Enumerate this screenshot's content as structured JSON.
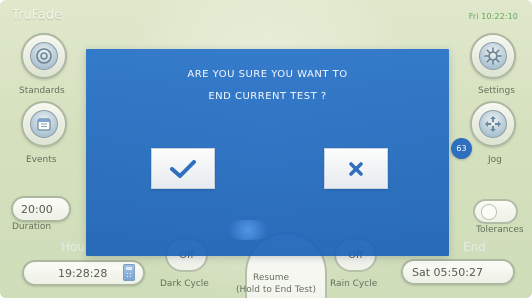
{
  "app": {
    "title": "TruFade",
    "clock": "Fri 10:22:10"
  },
  "buttons": {
    "standards": "Standards",
    "settings": "Settings",
    "events": "Events",
    "jog": "Jog",
    "duration": "Duration",
    "tolerances": "Tolerances"
  },
  "fields": {
    "duration_value": "20:00",
    "time_value": "19:28:28",
    "end_value": "Sat  05:50:27"
  },
  "hints": {
    "left_partial": "Hou",
    "right_partial": "End"
  },
  "bottom": {
    "dark_cycle_top": "Off",
    "rain_cycle_top": "Off",
    "dark_cycle": "Dark Cycle",
    "resume_line_1": "Resume",
    "resume_line_2": "(Hold to End Test)",
    "rain_cycle": "Rain Cycle"
  },
  "dialog": {
    "line1": "ARE YOU SURE YOU WANT TO",
    "line2": "END CURRENT TEST ?"
  },
  "badges": {
    "jog_count": "63"
  },
  "icons": {
    "standards": "target-icon",
    "settings": "gear-icon",
    "events": "calendar-icon",
    "jog": "move-arrows-icon",
    "confirm": "checkmark-icon",
    "cancel": "close-icon",
    "calculator": "calculator-icon"
  },
  "colors": {
    "dialog_blue": "#1f67bf",
    "accent_green": "#3c8f35"
  }
}
